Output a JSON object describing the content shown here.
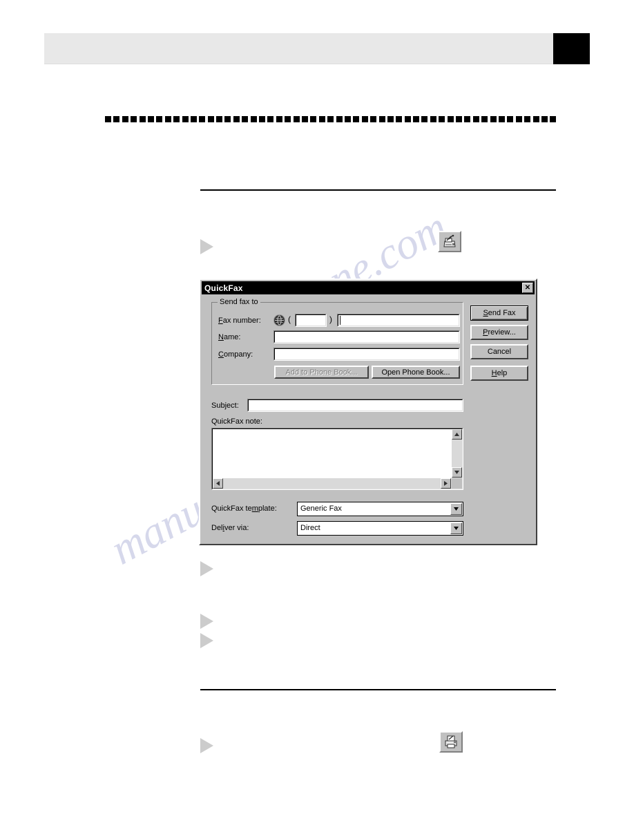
{
  "page": {
    "header_title": "",
    "tab_label": "",
    "body_lines": [
      "",
      "",
      "",
      ""
    ]
  },
  "icons": {
    "fax_machine": "fax-machine-icon",
    "printer": "printer-icon",
    "globe": "globe-icon",
    "close": "✕",
    "scroll_up": "▲",
    "scroll_down": "▼",
    "scroll_left": "◀",
    "scroll_right": "▶",
    "combo_arrow": "▼"
  },
  "watermark": {
    "line1": "manualshi",
    "line2": "ne.com"
  },
  "dialog": {
    "title": "QuickFax",
    "close_label": "✕",
    "group": {
      "legend": "Send fax to",
      "fields": [
        {
          "label": "Fax number:",
          "mnemonic": "F",
          "value": ""
        },
        {
          "label": "Name:",
          "mnemonic": "N",
          "value": ""
        },
        {
          "label": "Company:",
          "mnemonic": "C",
          "value": ""
        }
      ],
      "area_code": "",
      "paren_open": "(",
      "paren_close": ")",
      "buttons": [
        {
          "label": "Add to Phone Book...",
          "mnemonic": "A",
          "enabled": false
        },
        {
          "label": "Open Phone Book...",
          "mnemonic": "B",
          "enabled": true
        }
      ]
    },
    "subject": {
      "label": "Subject:",
      "mnemonic": "j",
      "value": ""
    },
    "note": {
      "label": "QuickFax note:",
      "value": ""
    },
    "selects": [
      {
        "label": "QuickFax template:",
        "mnemonic": "m",
        "value": "Generic Fax"
      },
      {
        "label": "Deliver via:",
        "mnemonic": "i",
        "value": "Direct"
      }
    ],
    "action_buttons": [
      {
        "label": "Send Fax",
        "default": true
      },
      {
        "label": "Preview...",
        "default": false
      },
      {
        "label": "Cancel",
        "default": false
      },
      {
        "label": "Help",
        "default": false
      }
    ]
  },
  "colors": {
    "dialog_face": "#c0c0c0",
    "titlebar": "#000000",
    "field_bg": "#ffffff",
    "header_bar": "#e8e8e8",
    "tab_black": "#000000",
    "arrow_bullet": "#cccccc"
  }
}
